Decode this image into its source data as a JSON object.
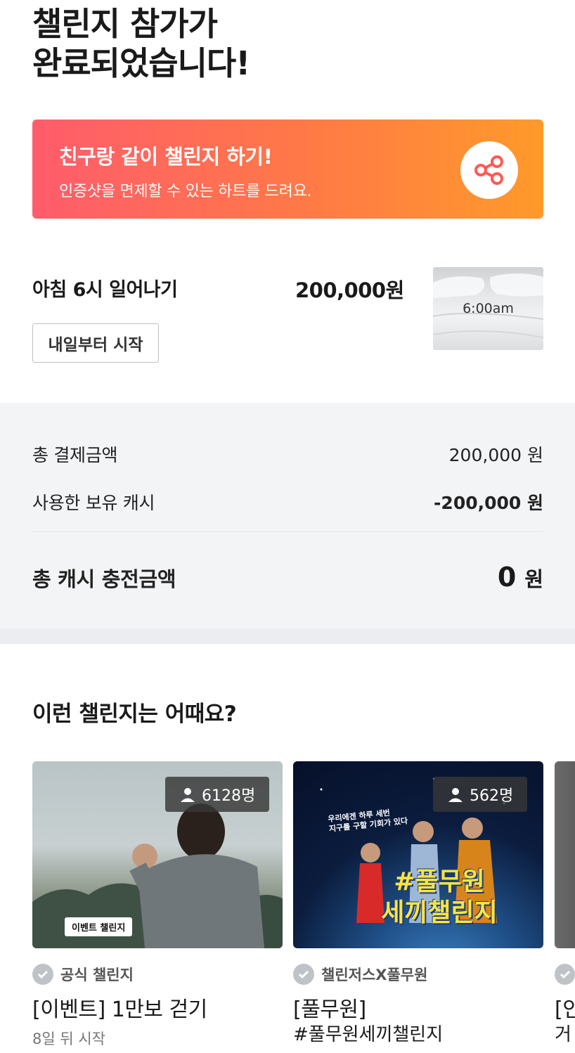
{
  "header": {
    "title_line1": "챌린지 참가가",
    "title_line2": "완료되었습니다!"
  },
  "share_banner": {
    "title": "친구랑 같이 챌린지 하기!",
    "subtitle": "인증샷을 면제할 수 있는 하트를 드려요.",
    "icon": "share-icon"
  },
  "challenge": {
    "name": "아침 6시 일어나기",
    "price": "200,000원",
    "start_label": "내일부터 시작",
    "thumbnail_text": "6:00am"
  },
  "summary": {
    "total_payment_label": "총 결제금액",
    "total_payment_value": "200,000 원",
    "used_cash_label": "사용한 보유 캐시",
    "used_cash_value": "-200,000 원",
    "charge_label": "총 캐시 충전금액",
    "charge_value": "0",
    "charge_unit": "원"
  },
  "recommend": {
    "title": "이런 챌린지는 어때요?",
    "cards": [
      {
        "count": "6128명",
        "tag": "이벤트 챌린지",
        "meta": "공식 챌린지",
        "name": "[이벤트] 1만보 걷기",
        "sub": "8일 뒤 시작"
      },
      {
        "count": "562명",
        "poster_small": "우리에겐 하루 세번\n지구를 구할 기회가 있다",
        "poster_text": "#풀무원\n세끼챌린지",
        "meta": "챌린저스X풀무원",
        "name": "[풀무원]",
        "name2": "#풀무원세끼챌린지"
      },
      {
        "meta": "",
        "name": "[인",
        "name2": "거"
      }
    ]
  },
  "colors": {
    "banner_start": "#ff5c6c",
    "banner_end": "#ff9a2a",
    "summary_bg": "#f3f4f6"
  }
}
